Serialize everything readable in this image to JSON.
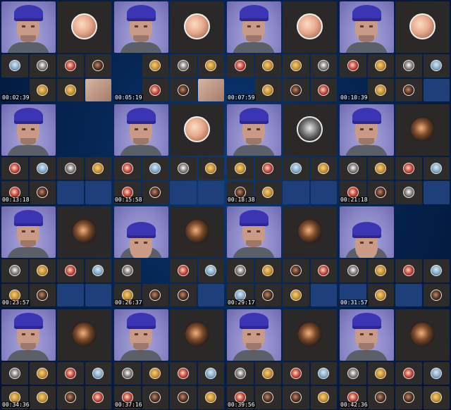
{
  "frames": [
    {
      "timestamp": "00:02:39",
      "main_participant": {
        "style": "peach",
        "empty": false
      },
      "participants": [
        "m-sky",
        "m-bw",
        "m-red",
        "m-dark",
        "",
        "m-gold",
        "m-gold",
        "photo"
      ],
      "cam_pose": "front"
    },
    {
      "timestamp": "00:05:19",
      "main_participant": {
        "style": "peach",
        "empty": false
      },
      "participants": [
        "",
        "m-gold",
        "m-bw",
        "m-gold",
        "",
        "m-red",
        "m-dark",
        "photo"
      ],
      "cam_pose": "front"
    },
    {
      "timestamp": "00:07:59",
      "main_participant": {
        "style": "peach",
        "empty": false
      },
      "participants": [
        "m-red",
        "m-gold",
        "m-gold",
        "m-bw",
        "",
        "m-gold",
        "m-dark",
        "m-red"
      ],
      "cam_pose": "front"
    },
    {
      "timestamp": "00:10:39",
      "main_participant": {
        "style": "peach",
        "empty": false
      },
      "participants": [
        "m-red",
        "m-gold",
        "m-bw",
        "m-sky",
        "",
        "m-gold",
        "m-dark",
        "blue"
      ],
      "cam_pose": "front"
    },
    {
      "timestamp": "00:13:18",
      "main_participant": {
        "style": "empty",
        "empty": true
      },
      "participants": [
        "m-red",
        "m-sky",
        "m-bw",
        "m-gold",
        "m-red",
        "m-dark",
        "blue",
        "blue"
      ],
      "cam_pose": "front"
    },
    {
      "timestamp": "00:15:58",
      "main_participant": {
        "style": "peach",
        "empty": false
      },
      "participants": [
        "m-red",
        "m-sky",
        "m-bw",
        "m-gold",
        "m-red",
        "m-dark",
        "blue",
        "blue"
      ],
      "cam_pose": "front"
    },
    {
      "timestamp": "00:18:38",
      "main_participant": {
        "style": "bw",
        "empty": false
      },
      "participants": [
        "m-gold",
        "m-red",
        "m-sky",
        "m-gold",
        "m-dark",
        "m-gold",
        "blue",
        "blue"
      ],
      "cam_pose": "front"
    },
    {
      "timestamp": "00:21:18",
      "main_participant": {
        "style": "dark",
        "empty": false
      },
      "participants": [
        "m-bw",
        "m-gold",
        "m-red",
        "m-sky",
        "m-red",
        "m-dark",
        "m-bw",
        "blue"
      ],
      "cam_pose": "front"
    },
    {
      "timestamp": "00:23:57",
      "main_participant": {
        "style": "dark",
        "empty": false
      },
      "participants": [
        "m-bw",
        "m-gold",
        "m-red",
        "m-sky",
        "m-gold",
        "m-dark",
        "blue",
        "blue"
      ],
      "cam_pose": "front"
    },
    {
      "timestamp": "00:26:37",
      "main_participant": {
        "style": "dark",
        "empty": false
      },
      "participants": [
        "m-bw",
        "",
        "m-red",
        "m-sky",
        "m-gold",
        "m-dark",
        "m-dark",
        "blue"
      ],
      "cam_pose": "away"
    },
    {
      "timestamp": "00:29:17",
      "main_participant": {
        "style": "dark",
        "empty": false
      },
      "participants": [
        "m-bw",
        "m-gold",
        "m-dark",
        "m-red",
        "m-sky",
        "m-dark",
        "m-gold",
        "blue"
      ],
      "cam_pose": "front"
    },
    {
      "timestamp": "00:31:57",
      "main_participant": {
        "style": "empty",
        "empty": true
      },
      "participants": [
        "m-bw",
        "m-gold",
        "m-red",
        "m-sky",
        "blue",
        "m-gold",
        "blue",
        "m-dark"
      ],
      "cam_pose": "away"
    },
    {
      "timestamp": "00:34:36",
      "main_participant": {
        "style": "dark",
        "empty": false
      },
      "participants": [
        "m-bw",
        "m-gold",
        "m-red",
        "m-sky",
        "m-gold",
        "m-gold",
        "m-dark",
        "m-red"
      ],
      "cam_pose": "front"
    },
    {
      "timestamp": "00:37:16",
      "main_participant": {
        "style": "dark",
        "empty": false
      },
      "participants": [
        "m-bw",
        "m-gold",
        "m-red",
        "m-sky",
        "m-red",
        "m-dark",
        "m-dark",
        "m-gold"
      ],
      "cam_pose": "front"
    },
    {
      "timestamp": "00:39:56",
      "main_participant": {
        "style": "dark",
        "empty": false
      },
      "participants": [
        "m-bw",
        "m-gold",
        "m-red",
        "m-sky",
        "m-red",
        "m-dark",
        "m-dark",
        "m-gold"
      ],
      "cam_pose": "front"
    },
    {
      "timestamp": "00:42:36",
      "main_participant": {
        "style": "dark",
        "empty": false
      },
      "participants": [
        "m-bw",
        "m-gold",
        "m-red",
        "m-sky",
        "m-red",
        "m-dark",
        "m-dark",
        "m-gold"
      ],
      "cam_pose": "front"
    }
  ]
}
